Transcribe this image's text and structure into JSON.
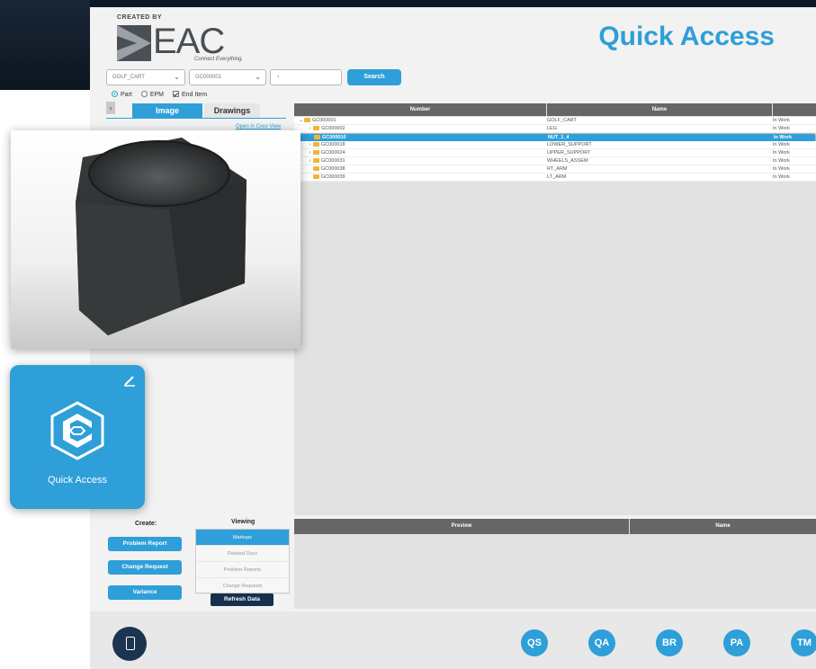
{
  "brand": {
    "created_by": "CREATED BY",
    "logo_text": "EAC",
    "tagline": "Connect Everything."
  },
  "page": {
    "title": "Quick Access"
  },
  "filters": {
    "category_value": "GOLF_CART",
    "number_value": "GC000001",
    "lookup_value": "",
    "search_label": "Search"
  },
  "type_options": {
    "part": "Part",
    "epm": "EPM",
    "end_item": "End Item"
  },
  "tabs": {
    "image": "Image",
    "drawings": "Drawings"
  },
  "open_creo_view": "Open in Creo View",
  "table": {
    "headers": {
      "number": "Number",
      "name": "Name",
      "state": ""
    },
    "rows": [
      {
        "number": "GC000001",
        "name": "GOLF_CART",
        "state": "In Work",
        "indent": 0,
        "twisty": "open"
      },
      {
        "number": "GC000002",
        "name": "LEG",
        "state": "In Work",
        "indent": 1,
        "twisty": "closed"
      },
      {
        "number": "GC000010",
        "name": "NUT_1_4",
        "state": "In Work",
        "indent": 1,
        "twisty": "none",
        "selected": true
      },
      {
        "number": "GC000018",
        "name": "LOWER_SUPPORT",
        "state": "In Work",
        "indent": 1,
        "twisty": "closed"
      },
      {
        "number": "GC000024",
        "name": "UPPER_SUPPORT",
        "state": "In Work",
        "indent": 1,
        "twisty": "closed"
      },
      {
        "number": "GC000031",
        "name": "WHEELS_ASSEM",
        "state": "In Work",
        "indent": 1,
        "twisty": "closed"
      },
      {
        "number": "GC000038",
        "name": "RT_ARM",
        "state": "In Work",
        "indent": 1,
        "twisty": "none"
      },
      {
        "number": "GC000039",
        "name": "LT_ARM",
        "state": "In Work",
        "indent": 1,
        "twisty": "none"
      }
    ]
  },
  "preview_table": {
    "headers": {
      "preview": "Preview",
      "name": "Name"
    }
  },
  "create": {
    "label": "Create:",
    "buttons": [
      "Problem Report",
      "Change Request",
      "Variance"
    ]
  },
  "viewing": {
    "label": "Viewing",
    "items": [
      "Markups",
      "Related Docs",
      "Problem Reports",
      "Change Requests"
    ],
    "selected_index": 0,
    "refresh_label": "Refresh Data"
  },
  "footer_nav": [
    "QS",
    "QA",
    "BR",
    "PA",
    "TM"
  ],
  "tile": {
    "label": "Quick Access"
  },
  "colors": {
    "accent": "#2e9fd8",
    "dark": "#14304d",
    "header_gray": "#666666"
  }
}
